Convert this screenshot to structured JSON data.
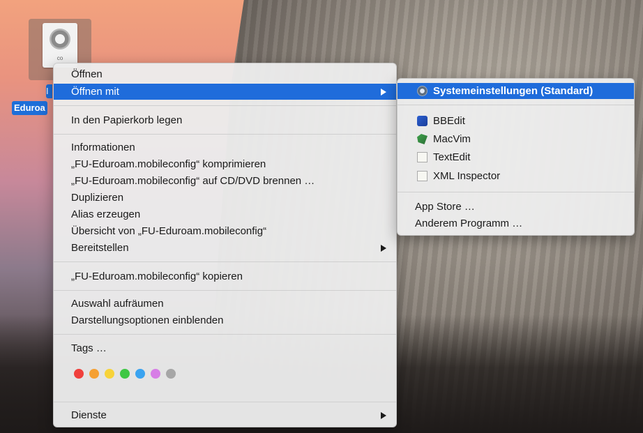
{
  "desktop": {
    "file_icon_ext": "co",
    "file_label_top": "I",
    "file_label": "Eduroa"
  },
  "context_menu": {
    "open": "Öffnen",
    "open_with": "Öffnen mit",
    "trash": "In den Papierkorb legen",
    "info": "Informationen",
    "compress": "„FU-Eduroam.mobileconfig“ komprimieren",
    "burn": "„FU-Eduroam.mobileconfig“ auf CD/DVD brennen …",
    "duplicate": "Duplizieren",
    "alias": "Alias erzeugen",
    "quicklook": "Übersicht von „FU-Eduroam.mobileconfig“",
    "share": "Bereitstellen",
    "copy": "„FU-Eduroam.mobileconfig“ kopieren",
    "clean_up": "Auswahl aufräumen",
    "view_options": "Darstellungsoptionen einblenden",
    "tags": "Tags …",
    "services": "Dienste",
    "tag_colors": [
      "#f0403c",
      "#f5a033",
      "#f7d33a",
      "#3ec744",
      "#3aa3f0",
      "#d77ee6",
      "#a6a6a6"
    ]
  },
  "submenu": {
    "default_app": "Systemeinstellungen (Standard)",
    "apps": [
      "BBEdit",
      "MacVim",
      "TextEdit",
      "XML Inspector"
    ],
    "app_store": "App Store …",
    "other": "Anderem Programm …"
  },
  "colors": {
    "highlight": "#1f6cdb"
  }
}
